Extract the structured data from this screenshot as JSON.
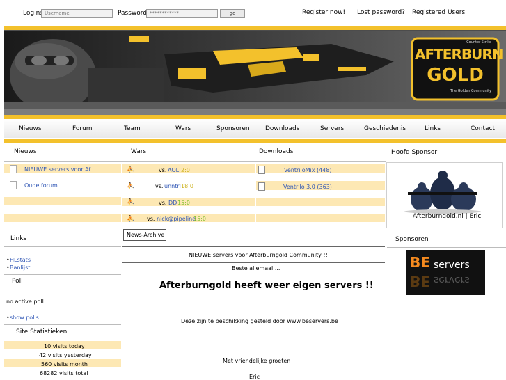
{
  "login": {
    "login_label": "Login:",
    "username_placeholder": "Username",
    "password_label": "Password:",
    "password_value": "************",
    "go_label": "go"
  },
  "toplinks": [
    "Register now!",
    "Lost password?",
    "Registered Users"
  ],
  "banner": {
    "logo_top": "Counter-Strike",
    "logo_word1": "AFTERBURN",
    "logo_word2": "GOLD",
    "logo_tagline": "The Golden Community"
  },
  "nav": [
    "Nieuws",
    "Forum",
    "Team",
    "Wars",
    "Sponsoren",
    "Downloads",
    "Servers",
    "Geschiedenis",
    "Links",
    "Contact"
  ],
  "sections": {
    "nieuws": "Nieuws",
    "wars": "Wars",
    "downloads": "Downloads",
    "hoofd_sponsor": "Hoofd Sponsor"
  },
  "news_items": [
    "NIEUWE servers voor Af..",
    "Oude forum"
  ],
  "wars": [
    {
      "vs": "vs.",
      "team": "AOL",
      "score": "2:0"
    },
    {
      "vs": "vs.",
      "team": "unntrl",
      "score": "18:0"
    },
    {
      "vs": "vs.",
      "team": "DD",
      "score": "15:0"
    },
    {
      "vs": "vs.",
      "team": "nick@pipeline",
      "score": "15:0"
    }
  ],
  "downloads": [
    "VentriloMix (448)",
    "Ventrilo 3.0 (363)"
  ],
  "sponsor_caption": "Afterburngold.nl | Eric",
  "links": {
    "title": "Links",
    "items": [
      "HLstats",
      "Banlijst"
    ]
  },
  "poll": {
    "title": "Poll",
    "status": "no active poll",
    "show_polls": "show polls"
  },
  "stats": {
    "title": "Site Statistieken",
    "lines": [
      "10 visits today",
      "42 visits yesterday",
      "560 visits month",
      "68282 visits total"
    ]
  },
  "news_archive": {
    "button": "News-Archive",
    "headline": "NIEUWE servers voor Afterburngold Community !!",
    "intro": "Beste allemaal....",
    "big_title": "Afterburngold heeft weer eigen servers !!",
    "body": "Deze zijn te beschikking gesteld door www.beservers.be",
    "regards": "Met vriendelijke groeten",
    "author": "Eric"
  },
  "sponsoren": {
    "title": "Sponsoren",
    "logo_be": "BE",
    "logo_servers": "servers"
  },
  "colors": {
    "accent": "#f3c12c",
    "row": "#fde8b4",
    "link": "#2f56b5",
    "score_green": "#7ebf2c"
  }
}
